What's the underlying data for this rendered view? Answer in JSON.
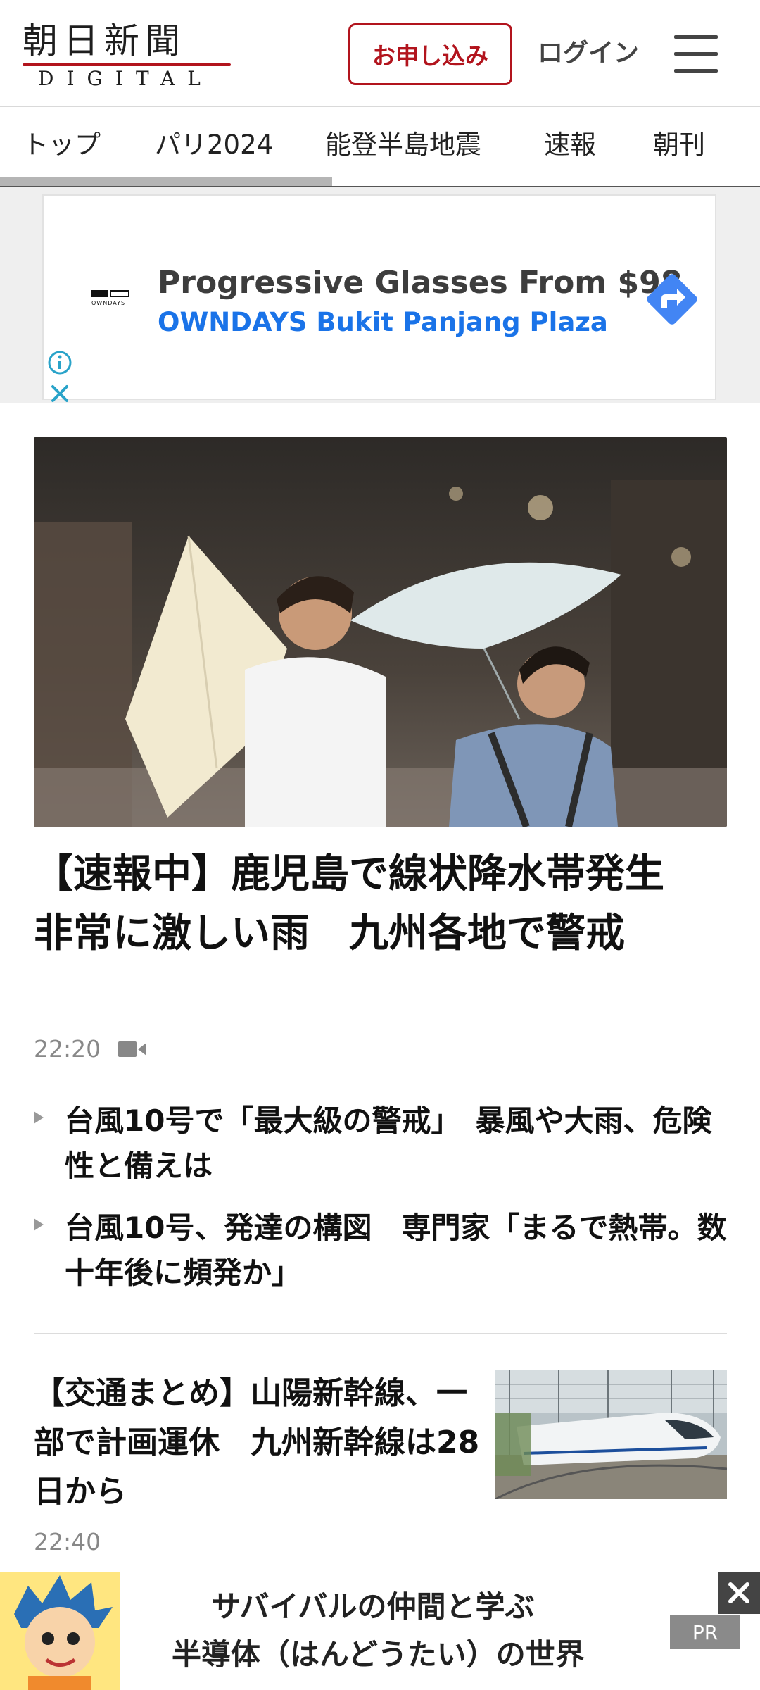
{
  "header": {
    "logo_main": "朝日新聞",
    "logo_sub": "DIGITAL",
    "subscribe_label": "お申し込み",
    "login_label": "ログイン",
    "menu_icon": "hamburger-menu-icon"
  },
  "nav": {
    "tabs": [
      {
        "label": "トップ"
      },
      {
        "label": "パリ2024"
      },
      {
        "label": "能登半島地震"
      },
      {
        "label": "速報"
      },
      {
        "label": "朝刊"
      }
    ]
  },
  "ad": {
    "brand_logo_text": "OWNDAYS",
    "headline": "Progressive Glasses From $98",
    "subline": "OWNDAYS Bukit Panjang Plaza",
    "arrow_icon": "directions-arrow-icon",
    "info_icon": "info-icon",
    "close_icon": "close-icon",
    "accent_color": "#1a73e8"
  },
  "main_article": {
    "photo": "two-young-men-with-umbrellas-in-wind-photo",
    "title": "【速報中】鹿児島で線状降水帯発生　非常に激しい雨　九州各地で警戒",
    "time": "22:20",
    "video_icon": "video-camera-icon",
    "related": [
      {
        "text": "台風10号で「最大級の警戒」　暴風や大雨、危険性と備えは"
      },
      {
        "text": "台風10号、発達の構図　専門家「まるで熱帯。数十年後に頻発か」"
      }
    ]
  },
  "article2": {
    "title": "【交通まとめ】山陽新幹線、一部で計画運休　九州新幹線は28日から",
    "time": "22:40",
    "photo": "shinkansen-train-photo"
  },
  "bottom_banner": {
    "line1": "サバイバルの仲間と学ぶ",
    "line2": "半導体（はんどうたい）の世界",
    "pr_label": "PR",
    "close_icon": "close-icon",
    "character": "cartoon-boy-character"
  },
  "colors": {
    "brand_red": "#b2141d",
    "ad_blue": "#1a73e8"
  }
}
